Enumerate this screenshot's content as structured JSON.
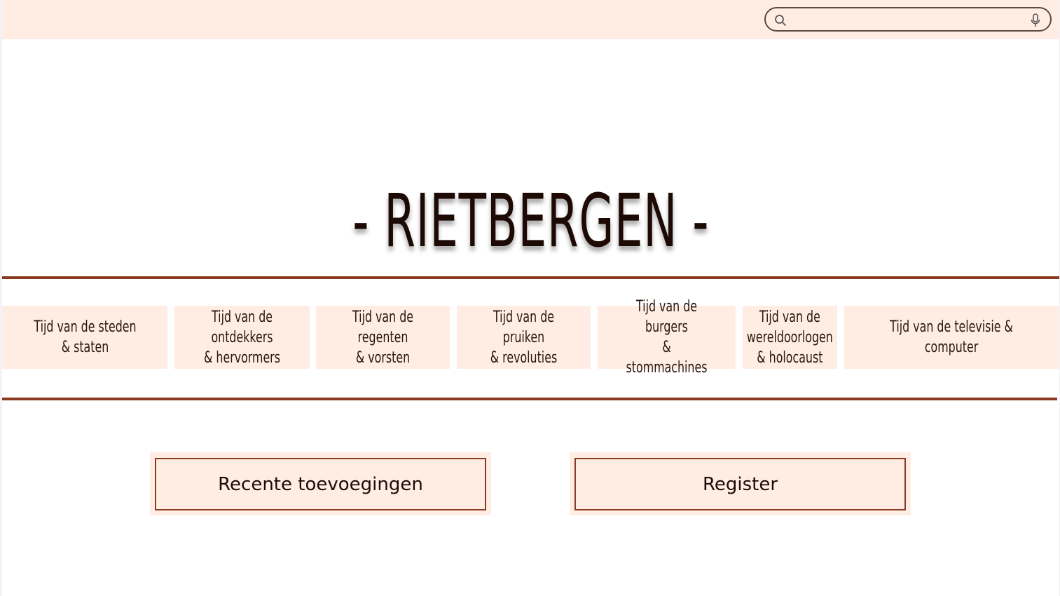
{
  "header": {
    "search": {
      "placeholder": "",
      "value": "",
      "icon": "search-icon",
      "voice_icon": "microphone-icon"
    }
  },
  "site_title": "- RIETBERGEN -",
  "nav": {
    "items": [
      {
        "label": "Tijd van de steden\n& staten"
      },
      {
        "label": "Tijd van de ontdekkers\n& hervormers"
      },
      {
        "label": "Tijd van de regenten\n& vorsten"
      },
      {
        "label": "Tijd van de pruiken\n& revoluties"
      },
      {
        "label": "Tijd van de burgers\n& stommachines"
      },
      {
        "label": "Tijd van de\nwereldoorlogen\n& holocaust"
      },
      {
        "label": "Tijd van de televisie &\ncomputer"
      }
    ]
  },
  "actions": {
    "recent_label": "Recente toevoegingen",
    "register_label": "Register"
  },
  "colors": {
    "accent": "#8a3a21",
    "panel": "#ffede4",
    "title": "#1e0a05"
  }
}
